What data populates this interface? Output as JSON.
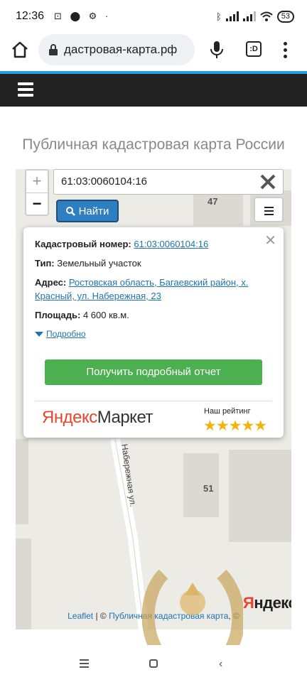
{
  "status_bar": {
    "time": "12:36",
    "battery": "53"
  },
  "browser": {
    "url": "дастровая-карта.рф"
  },
  "page": {
    "title": "Публичная кадастровая карта России"
  },
  "search": {
    "value": "61:03:0060104:16",
    "find_label": "Найти",
    "zoom_in": "+",
    "zoom_out": "−"
  },
  "map": {
    "parcels": [
      "47",
      "51"
    ],
    "street": "Набережная ул.",
    "yandex": {
      "part1": "Я",
      "part2": "ндекс"
    }
  },
  "popup": {
    "cad_label": "Кадастровый номер:",
    "cad_value": "61:03:0060104:16",
    "type_label": "Тип:",
    "type_value": "Земельный участок",
    "address_label": "Адрес:",
    "address_value": "Ростовская область, Багаевский район, х. Красный, ул. Набережная, 23",
    "area_label": "Площадь:",
    "area_value": "4 600 кв.м.",
    "more_label": "Подробно",
    "report_button": "Получить подробный отчет",
    "ym_part1": "Яндекс",
    "ym_part2": "Маркет",
    "rating_label": "Наш рейтинг",
    "rating_stars": 5,
    "stars": "★★★★★"
  },
  "attribution": {
    "leaflet": "Leaflet",
    "separator": " | © ",
    "source": "Публичная кадастровая карта",
    "suffix": ", ©"
  },
  "colors": {
    "accent": "#2a9fd6",
    "find_button": "#2f7ec2",
    "report_button": "#4caf50",
    "link": "#2074b0",
    "stars": "#f2b30c"
  }
}
